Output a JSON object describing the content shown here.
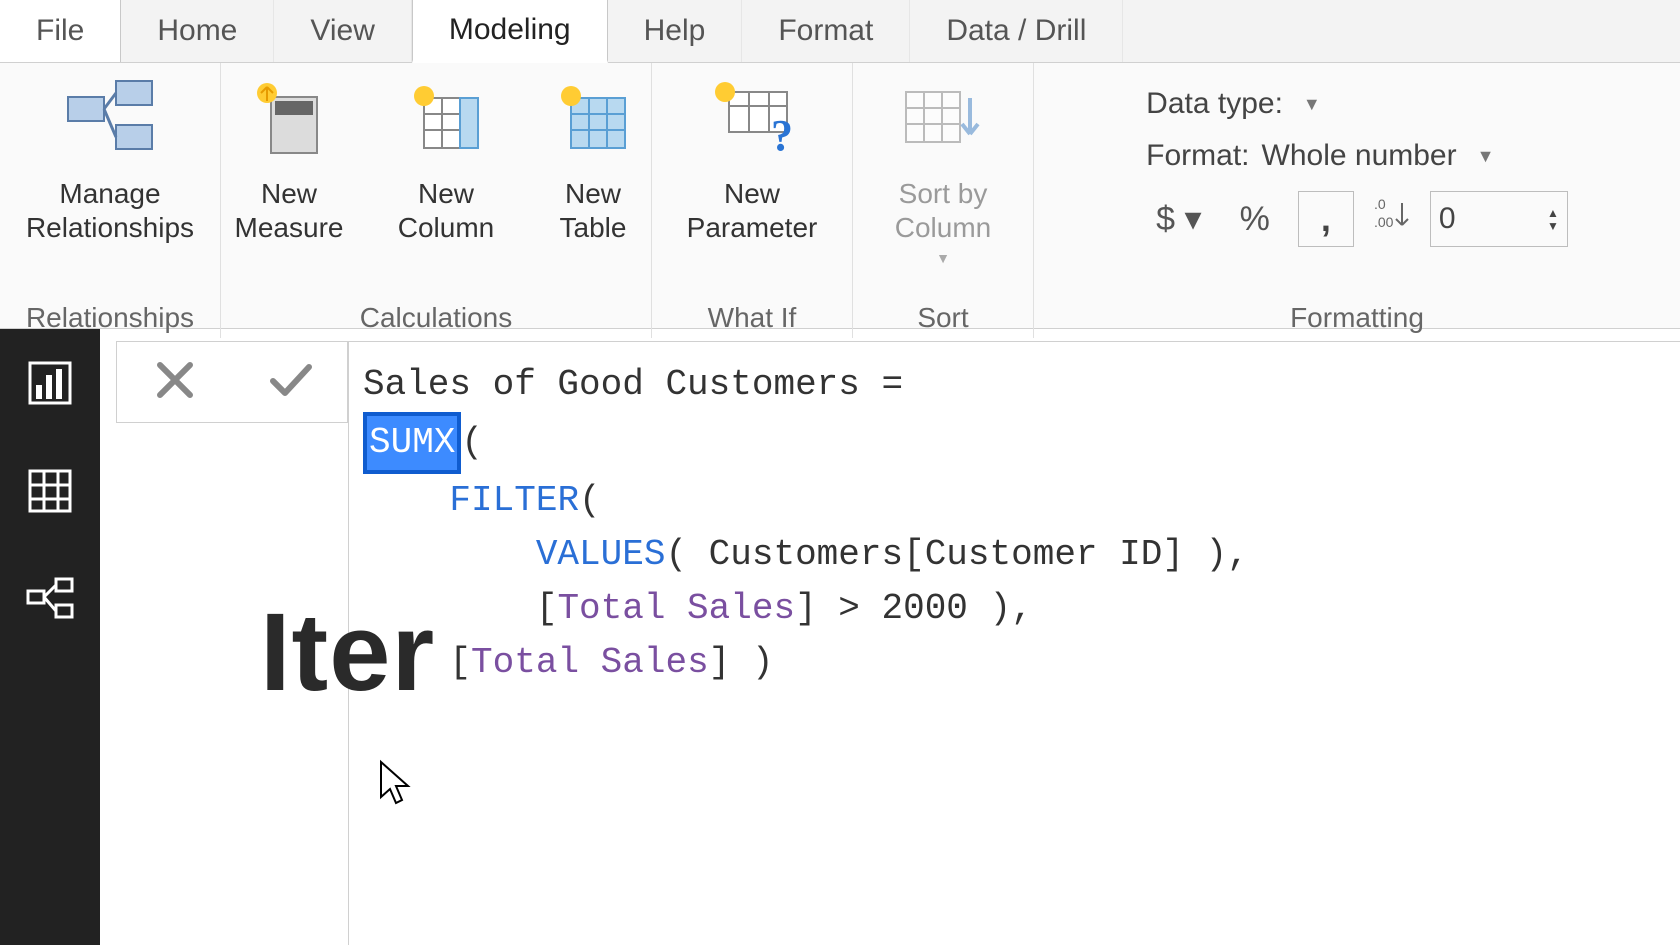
{
  "tabs": {
    "file": "File",
    "home": "Home",
    "view": "View",
    "modeling": "Modeling",
    "help": "Help",
    "format": "Format",
    "data_drill": "Data / Drill"
  },
  "ribbon": {
    "relationships": {
      "manage": "Manage\nRelationships",
      "group": "Relationships"
    },
    "calculations": {
      "new_measure": "New\nMeasure",
      "new_column": "New\nColumn",
      "new_table": "New\nTable",
      "group": "Calculations"
    },
    "whatif": {
      "new_parameter": "New\nParameter",
      "group": "What If"
    },
    "sort": {
      "sort_by_column": "Sort by\nColumn",
      "group": "Sort"
    },
    "formatting": {
      "data_type_label": "Data type:",
      "format_label": "Format: ",
      "format_value": "Whole number",
      "currency": "$",
      "percent": "%",
      "comma": ",",
      "dec_symbol": ".0\n.00",
      "decimals": "0",
      "group": "Formatting"
    }
  },
  "formula": {
    "title": "Sales of Good Customers =",
    "fn_sumx": "SUMX",
    "paren_after_sumx": "(",
    "fn_filter": "FILTER",
    "filter_open": "(",
    "fn_values": "VALUES",
    "values_args": "( Customers[Customer ID] ),",
    "total_sales": "Total Sales",
    "gt_clause": "] > 2000 ),",
    "closing": " )"
  },
  "canvas_text": "Iter"
}
